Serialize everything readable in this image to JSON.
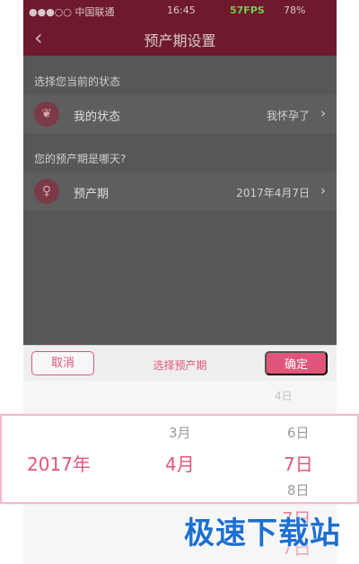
{
  "status_bar": {
    "carrier": "●●●○○ 中国联通",
    "time": "16:45",
    "fps": "57FPS",
    "battery": "78%"
  },
  "nav": {
    "back": "‹",
    "title": "预产期设置"
  },
  "sections": {
    "state_label": "选择您当前的状态",
    "state_row": {
      "icon": "sprout-icon",
      "label": "我的状态",
      "value": "我怀孕了"
    },
    "due_label": "您的预产期是哪天?",
    "due_row": {
      "icon": "pregnant-icon",
      "label": "预产期",
      "value": "2017年4月7日"
    }
  },
  "picker": {
    "cancel": "取消",
    "title": "选择预产期",
    "confirm": "确定",
    "above_day": "4日",
    "year_selected": "2017年",
    "month_above": "3月",
    "month_selected": "4月",
    "day_above": "6日",
    "day_selected": "7日",
    "day_below": "8日",
    "ghost_day": "7日"
  },
  "watermark": "极速下载站",
  "colors": {
    "accent": "#e2557a",
    "nav_dimmed": "#6f1a2c",
    "overlay_gray": "#575757"
  }
}
